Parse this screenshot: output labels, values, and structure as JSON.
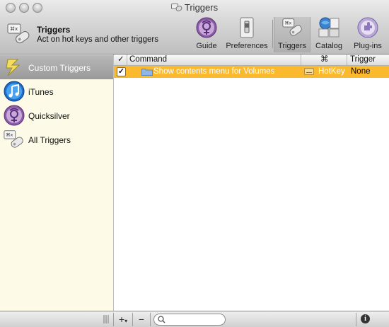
{
  "window": {
    "title": "Triggers"
  },
  "header": {
    "title": "Triggers",
    "subtitle": "Act on hot keys and other triggers"
  },
  "toolbar": {
    "items": [
      {
        "label": "Guide",
        "icon": "quicksilver-icon"
      },
      {
        "label": "Preferences",
        "icon": "switch-icon"
      },
      {
        "label": "Triggers",
        "icon": "triggers-icon",
        "active": true
      },
      {
        "label": "Catalog",
        "icon": "catalog-icon"
      },
      {
        "label": "Plug-ins",
        "icon": "plugin-icon"
      }
    ]
  },
  "sidebar": {
    "items": [
      {
        "label": "Custom Triggers",
        "icon": "lightning-icon",
        "selected": true
      },
      {
        "label": "iTunes",
        "icon": "itunes-icon"
      },
      {
        "label": "Quicksilver",
        "icon": "quicksilver-icon"
      },
      {
        "label": "All Triggers",
        "icon": "triggers-icon"
      }
    ]
  },
  "table": {
    "columns": [
      "✓",
      "Command",
      "⌘",
      "Trigger"
    ],
    "rows": [
      {
        "enabled": true,
        "command": "Show contents menu for Volumes",
        "shortcut": "HotKey",
        "trigger": "None"
      }
    ]
  },
  "bottombar": {
    "add_label": "+",
    "add_menu_label": "▾",
    "remove_label": "−",
    "search_placeholder": "",
    "info_label": "i"
  },
  "colors": {
    "selection": "#fbb92d",
    "sidebar_bg": "#fdfbe7",
    "sidebar_selected": "#a9a9a9"
  }
}
